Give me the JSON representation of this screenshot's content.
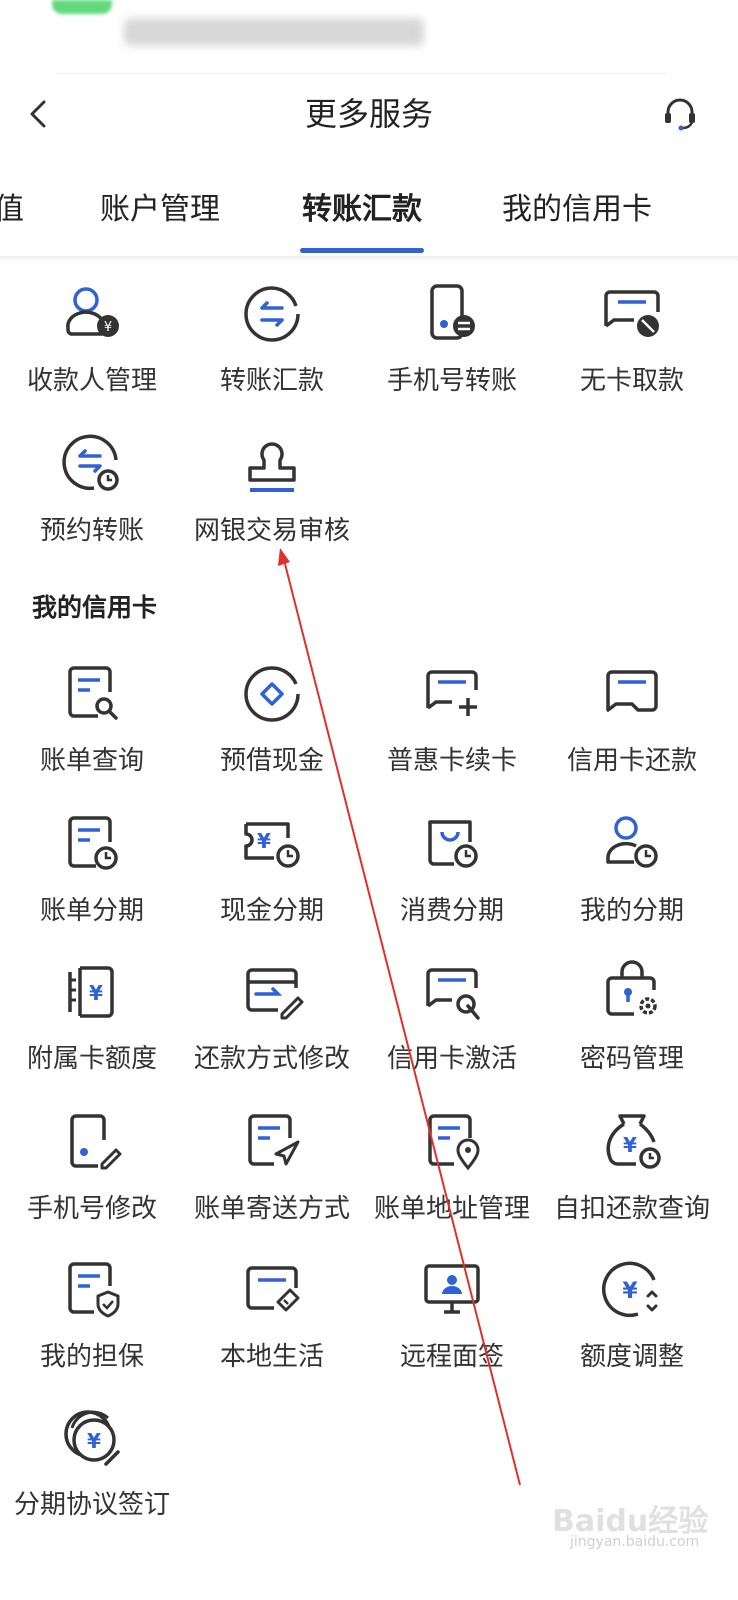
{
  "header": {
    "title": "更多服务"
  },
  "tabs": [
    {
      "label": "值"
    },
    {
      "label": "账户管理"
    },
    {
      "label": "转账汇款",
      "active": true
    },
    {
      "label": "我的信用卡"
    }
  ],
  "transfer": {
    "items": [
      {
        "label": "收款人管理",
        "icon": "payee-icon"
      },
      {
        "label": "转账汇款",
        "icon": "transfer-icon"
      },
      {
        "label": "手机号转账",
        "icon": "phone-transfer-icon"
      },
      {
        "label": "无卡取款",
        "icon": "cardless-withdraw-icon"
      },
      {
        "label": "预约转账",
        "icon": "scheduled-transfer-icon"
      },
      {
        "label": "网银交易审核",
        "icon": "stamp-icon"
      }
    ]
  },
  "credit": {
    "section_title": "我的信用卡",
    "items": [
      {
        "label": "账单查询",
        "icon": "bill-search-icon"
      },
      {
        "label": "预借现金",
        "icon": "cash-advance-icon"
      },
      {
        "label": "普惠卡续卡",
        "icon": "card-renew-icon"
      },
      {
        "label": "信用卡还款",
        "icon": "card-repay-icon"
      },
      {
        "label": "账单分期",
        "icon": "bill-installment-icon"
      },
      {
        "label": "现金分期",
        "icon": "cash-installment-icon"
      },
      {
        "label": "消费分期",
        "icon": "consume-installment-icon"
      },
      {
        "label": "我的分期",
        "icon": "my-installment-icon"
      },
      {
        "label": "附属卡额度",
        "icon": "supplementary-card-icon"
      },
      {
        "label": "还款方式修改",
        "icon": "repay-method-icon"
      },
      {
        "label": "信用卡激活",
        "icon": "card-activate-icon"
      },
      {
        "label": "密码管理",
        "icon": "password-icon"
      },
      {
        "label": "手机号修改",
        "icon": "phone-edit-icon"
      },
      {
        "label": "账单寄送方式",
        "icon": "bill-send-icon"
      },
      {
        "label": "账单地址管理",
        "icon": "bill-address-icon"
      },
      {
        "label": "自扣还款查询",
        "icon": "auto-repay-icon"
      },
      {
        "label": "我的担保",
        "icon": "guarantee-icon"
      },
      {
        "label": "本地生活",
        "icon": "local-life-icon"
      },
      {
        "label": "远程面签",
        "icon": "remote-sign-icon"
      },
      {
        "label": "额度调整",
        "icon": "limit-adjust-icon"
      },
      {
        "label": "分期协议签订",
        "icon": "agreement-icon"
      }
    ]
  },
  "watermark": {
    "text": "Baidu经验",
    "sub": "jingyan.baidu.com"
  },
  "colors": {
    "accent": "#2f62d6",
    "icon_dark": "#333333",
    "annotation": "#e0302c"
  }
}
